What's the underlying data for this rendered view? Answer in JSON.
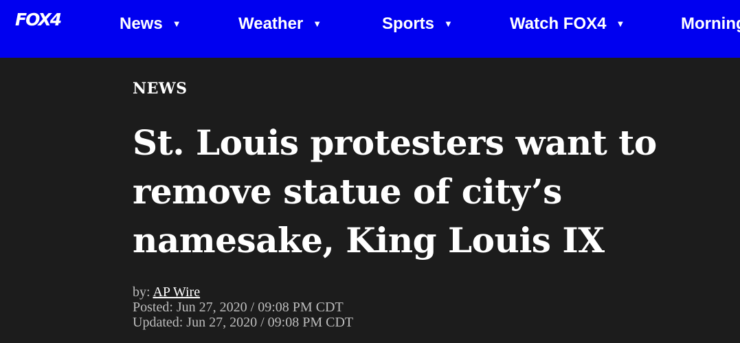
{
  "header": {
    "logo": "FOX4",
    "nav": [
      {
        "label": "News",
        "caret": "▼"
      },
      {
        "label": "Weather",
        "caret": "▼"
      },
      {
        "label": "Sports",
        "caret": "▼"
      },
      {
        "label": "Watch FOX4",
        "caret": "▼"
      },
      {
        "label": "Morning"
      }
    ],
    "colors": {
      "bar": "#0000f0",
      "text": "#ffffff"
    }
  },
  "article": {
    "section": "NEWS",
    "headline": "St. Louis protesters want to remove statue of city’s namesake, King Louis IX",
    "byline_prefix": "by: ",
    "author": "AP Wire",
    "posted": "Posted: Jun 27, 2020 / 09:08 PM CDT",
    "updated": "Updated: Jun 27, 2020 / 09:08 PM CDT"
  },
  "colors": {
    "page_background": "#1c1c1c",
    "meta_text": "#bdbdbd"
  }
}
